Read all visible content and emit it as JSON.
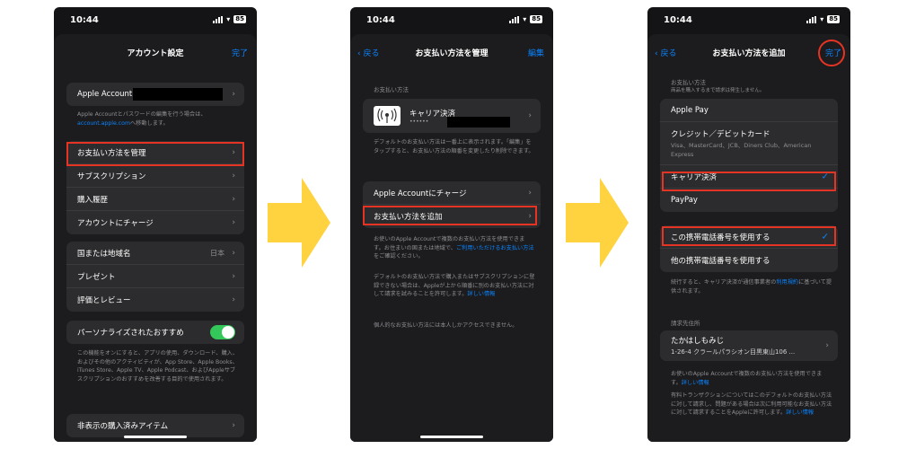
{
  "status": {
    "time": "10:44",
    "battery": "85"
  },
  "screen1": {
    "title": "アカウント設定",
    "done": "完了",
    "apple_account": "Apple Account",
    "note1_a": "Apple Accountとパスワードの編集を行う場合は、",
    "note1_link": "account.apple.com",
    "note1_b": "へ移動します。",
    "items1": [
      "お支払い方法を管理",
      "サブスクリプション",
      "購入履歴",
      "アカウントにチャージ"
    ],
    "items2": [
      "国または地域名",
      "プレゼント",
      "評価とレビュー"
    ],
    "region_value": "日本",
    "personalize": "パーソナライズされたおすすめ",
    "note2": "この機能をオンにすると、アプリの使用、ダウンロード、購入、およびその他のアクティビティが、App Store、Apple Books、iTunes Store、Apple TV、Apple Podcast、およびAppleサブスクリプションのおすすめを改善する目的で使用されます。",
    "hidden_purchases": "非表示の購入済みアイテム"
  },
  "screen2": {
    "back": "戻る",
    "title": "お支払い方法を管理",
    "edit": "編集",
    "section": "お支払い方法",
    "carrier": "キャリア決済",
    "carrier_dots": "••••••",
    "note1": "デフォルトのお支払い方法は一番上に表示されます。「編集」をタップすると、お支払い方法の順番を変更したり削除できます。",
    "items": [
      "Apple Accountにチャージ",
      "お支払い方法を追加"
    ],
    "note2_a": "お使いのApple Accountで複数のお支払い方法を使用できます。お住まいの国または地域で、",
    "note2_link": "ご利用いただけるお支払い方法",
    "note2_b": "をご確認ください。",
    "note3_a": "デフォルトのお支払い方法で購入またはサブスクリプションに登録できない場合は、Appleが上から順番に別のお支払い方法に対して請求を試みることを許可します。",
    "note3_link": "詳しい情報",
    "note4": "個人的なお支払い方法には本人しかアクセスできません。"
  },
  "screen3": {
    "back": "戻る",
    "title": "お支払い方法を追加",
    "done": "完了",
    "section": "お支払い方法",
    "section_sub": "商品を購入するまで請求は発生しません。",
    "apple_pay": "Apple Pay",
    "card": "クレジット／デビットカード",
    "card_sub": "Visa、MasterCard、JCB、Diners Club、American Express",
    "carrier": "キャリア決済",
    "paypay": "PayPay",
    "use_this": "この携帯電話番号を使用する",
    "use_other": "他の携帯電話番号を使用する",
    "note1_a": "続行すると、キャリア決済が通信事業者の",
    "note1_link": "利用規約",
    "note1_b": "に基づいて提供されます。",
    "billing": "請求先住所",
    "name": "たかはしもみじ",
    "address": "1-26-4 クラールパラシオン目黒東山106 ...",
    "note2_a": "お使いのApple Accountで複数のお支払い方法を使用できます。",
    "note2_link": "詳しい情報",
    "note3_a": "有料トランザクションについてはこのデフォルトのお支払い方法に対して請求し、問題がある場合は次に利用可能なお支払い方法に対して請求することをAppleに許可します。",
    "note3_link": "詳しい情報"
  },
  "colors": {
    "accent": "#0a84ff",
    "highlight": "#e53424",
    "arrow": "#ffd23f",
    "toggle": "#34c759"
  }
}
